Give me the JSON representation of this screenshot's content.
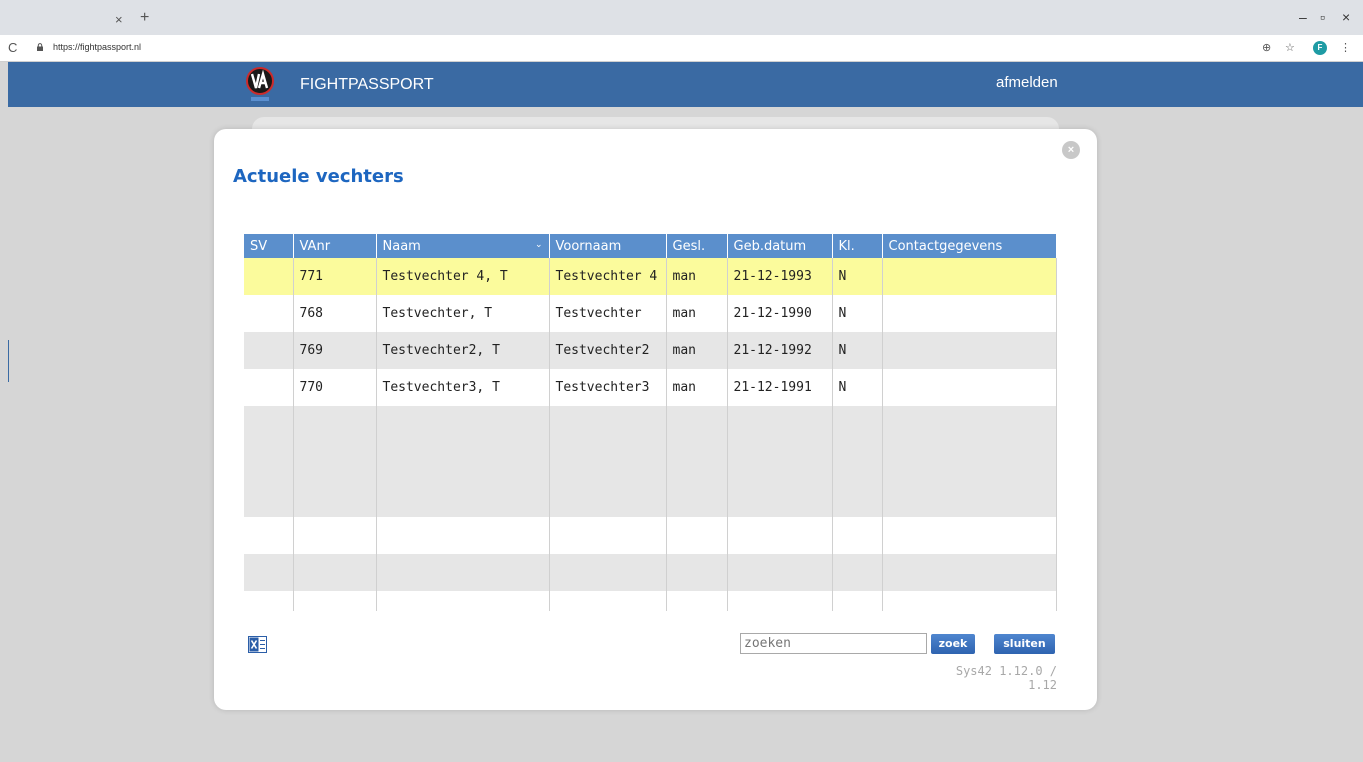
{
  "browser": {
    "tab_close": "×",
    "new_tab": "+",
    "url": "https://fightpassport.nl",
    "profile_initial": "F",
    "minimize": "–",
    "restore": "▫",
    "close": "×"
  },
  "header": {
    "title": "FIGHTPASSPORT",
    "logout_label": "afmelden",
    "color": "#3a6aa3"
  },
  "modal": {
    "title": "Actuele vechters",
    "close_icon": "×",
    "columns": [
      "SV",
      "VAnr",
      "Naam",
      "Voornaam",
      "Gesl.",
      "Geb.datum",
      "Kl.",
      "Contactgegevens"
    ],
    "rows": [
      {
        "sv": "",
        "vanr": "771",
        "naam": "Testvechter 4, T",
        "voornaam": "Testvechter 4",
        "gesl": "man",
        "gebdatum": "21-12-1993",
        "kl": "N",
        "contact": ""
      },
      {
        "sv": "",
        "vanr": "768",
        "naam": "Testvechter, T",
        "voornaam": "Testvechter",
        "gesl": "man",
        "gebdatum": "21-12-1990",
        "kl": "N",
        "contact": ""
      },
      {
        "sv": "",
        "vanr": "769",
        "naam": "Testvechter2, T",
        "voornaam": "Testvechter2",
        "gesl": "man",
        "gebdatum": "21-12-1992",
        "kl": "N",
        "contact": ""
      },
      {
        "sv": "",
        "vanr": "770",
        "naam": "Testvechter3, T",
        "voornaam": "Testvechter3",
        "gesl": "man",
        "gebdatum": "21-12-1991",
        "kl": "N",
        "contact": ""
      }
    ],
    "search_placeholder": "zoeken",
    "search_button": "zoek",
    "close_button": "sluiten",
    "version": "Sys42 1.12.0 / 1.12",
    "selected_row_color": "#fbfb9c",
    "accent": "#1d66c0"
  }
}
